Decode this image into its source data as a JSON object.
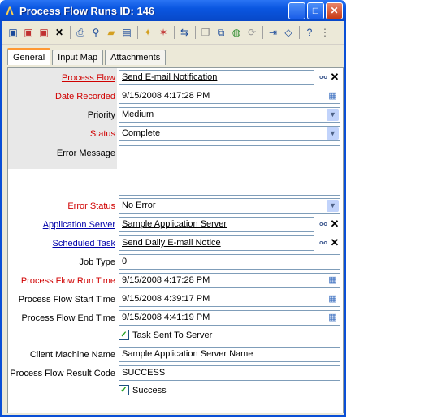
{
  "window": {
    "title": "Process Flow Runs ID: 146"
  },
  "tabs": [
    "General",
    "Input Map",
    "Attachments"
  ],
  "fields": {
    "process_flow": {
      "label": "Process Flow",
      "value": "Send E-mail Notification"
    },
    "date_recorded": {
      "label": "Date Recorded",
      "value": "9/15/2008 4:17:28 PM"
    },
    "priority": {
      "label": "Priority",
      "value": "Medium"
    },
    "status": {
      "label": "Status",
      "value": "Complete"
    },
    "error_message": {
      "label": "Error Message",
      "value": ""
    },
    "error_status": {
      "label": "Error Status",
      "value": "No Error"
    },
    "application_server": {
      "label": "Application Server",
      "value": "Sample Application Server"
    },
    "scheduled_task": {
      "label": "Scheduled Task",
      "value": "Send Daily E-mail Notice"
    },
    "job_type": {
      "label": "Job Type",
      "value": "0"
    },
    "run_time": {
      "label": "Process Flow Run Time",
      "value": "9/15/2008 4:17:28 PM"
    },
    "start_time": {
      "label": "Process Flow Start Time",
      "value": "9/15/2008 4:39:17 PM"
    },
    "end_time": {
      "label": "Process Flow End Time",
      "value": "9/15/2008 4:41:19 PM"
    },
    "task_sent": {
      "label": "Task Sent To Server",
      "checked": true
    },
    "client_machine": {
      "label": "Client Machine Name",
      "value": "Sample Application Server Name"
    },
    "result_code": {
      "label": "Process Flow Result Code",
      "value": "SUCCESS"
    },
    "success": {
      "label": "Success",
      "checked": true
    }
  },
  "colors": {
    "title_bar": "#0a56e0",
    "required_label": "#d00000",
    "link_label": "#0000aa",
    "panel_bg": "#ece9d8"
  },
  "toolbar_icons": [
    "save-icon",
    "save-new-icon",
    "save-close-icon",
    "delete-icon",
    "print-icon",
    "find-icon",
    "open-icon",
    "window-icon",
    "wizard-icon",
    "tools-icon",
    "link-icon",
    "copy-icon",
    "merge-icon",
    "globe-icon",
    "refresh-icon",
    "import-icon",
    "eraser-icon",
    "help-icon"
  ]
}
